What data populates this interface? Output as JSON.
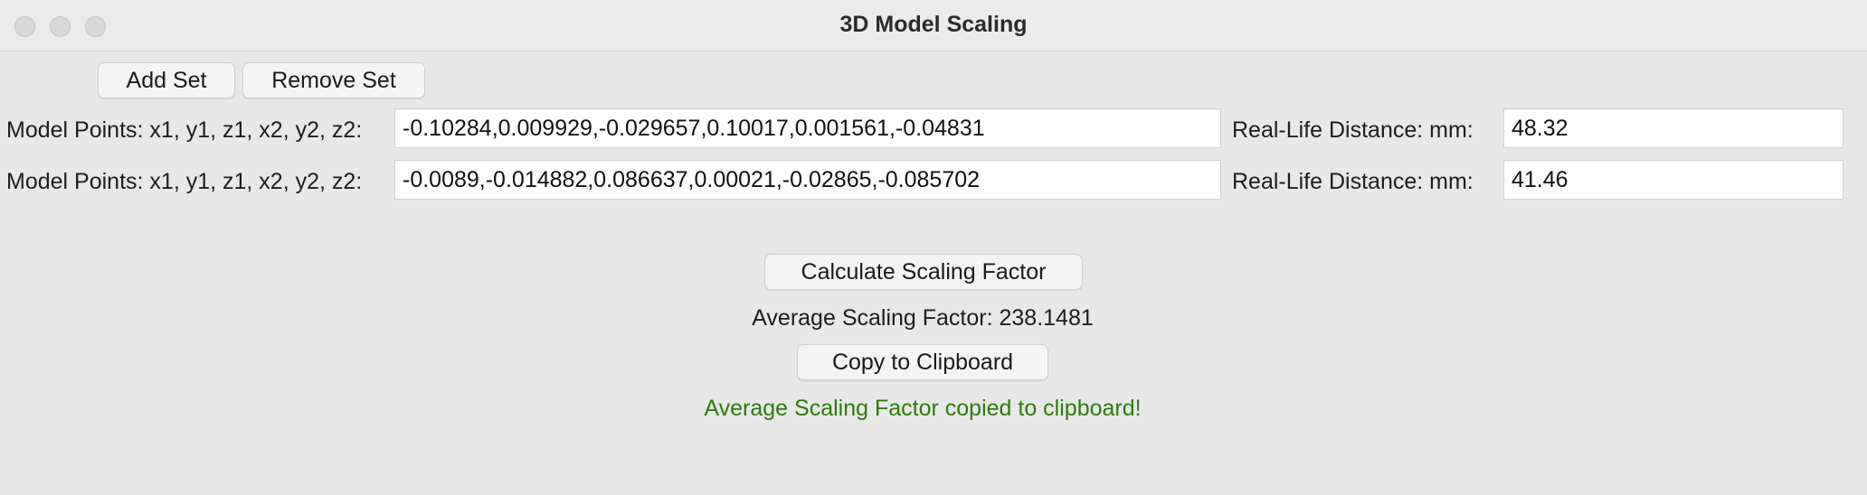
{
  "window": {
    "title": "3D Model Scaling"
  },
  "toolbar": {
    "add_set_label": "Add Set",
    "remove_set_label": "Remove Set"
  },
  "sets": [
    {
      "model_label": "Model Points: x1, y1, z1, x2, y2, z2:",
      "model_value": "-0.10284,0.009929,-0.029657,0.10017,0.001561,-0.04831",
      "distance_label": "Real-Life Distance: mm:",
      "distance_value": "48.32"
    },
    {
      "model_label": "Model Points: x1, y1, z1, x2, y2, z2:",
      "model_value": "-0.0089,-0.014882,0.086637,0.00021,-0.02865,-0.085702",
      "distance_label": "Real-Life Distance: mm:",
      "distance_value": "41.46"
    }
  ],
  "actions": {
    "calculate_label": "Calculate Scaling Factor",
    "result_text": "Average Scaling Factor: 238.1481",
    "copy_label": "Copy to Clipboard",
    "status_text": "Average Scaling Factor copied to clipboard!"
  },
  "colors": {
    "status_text": "#2f7a0f",
    "background": "#e8e8e8"
  }
}
